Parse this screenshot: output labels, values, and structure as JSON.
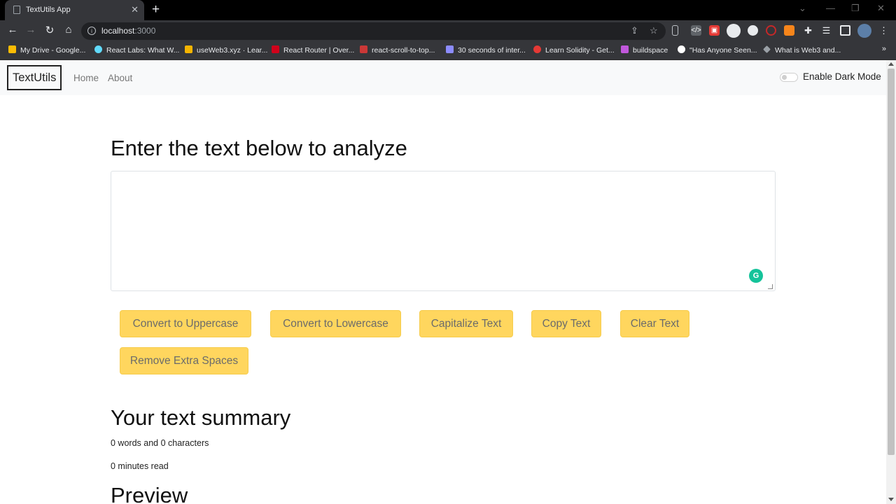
{
  "browser": {
    "tab_title": "TextUtils App",
    "new_tab_label": "+",
    "close_tab_label": "✕",
    "url_host": "localhost",
    "url_port": ":3000",
    "bookmarks": [
      {
        "label": "My Drive - Google...",
        "color": "#fbbc04"
      },
      {
        "label": "React Labs: What W...",
        "color": "#61dafb"
      },
      {
        "label": "useWeb3.xyz · Lear...",
        "color": "#f4b400"
      },
      {
        "label": "React Router | Over...",
        "color": "#d0021b"
      },
      {
        "label": "react-scroll-to-top...",
        "color": "#cb3837"
      },
      {
        "label": "30 seconds of inter...",
        "color": "#8c8cff"
      },
      {
        "label": "Learn Solidity - Get...",
        "color": "#e53935"
      },
      {
        "label": "buildspace",
        "color": "#c158dc"
      },
      {
        "label": "\"Has Anyone Seen...",
        "color": "#ffffff"
      },
      {
        "label": "What is Web3 and...",
        "color": "#9aa0a6"
      }
    ],
    "more_bookmarks": "»"
  },
  "navbar": {
    "brand": "TextUtils",
    "links": [
      "Home",
      "About"
    ],
    "dark_mode_label": "Enable Dark Mode"
  },
  "main": {
    "heading": "Enter the text below to analyze",
    "textarea_value": "",
    "buttons": [
      "Convert to Uppercase",
      "Convert to Lowercase",
      "Capitalize Text",
      "Copy Text",
      "Clear Text",
      "Remove Extra Spaces"
    ]
  },
  "summary": {
    "heading": "Your text summary",
    "counts": "0 words and 0 characters",
    "read_time": "0 minutes read",
    "preview_heading": "Preview"
  },
  "colors": {
    "button_bg": "#ffd65e",
    "button_text": "#6b6b6b",
    "grammarly": "#15c39a"
  }
}
